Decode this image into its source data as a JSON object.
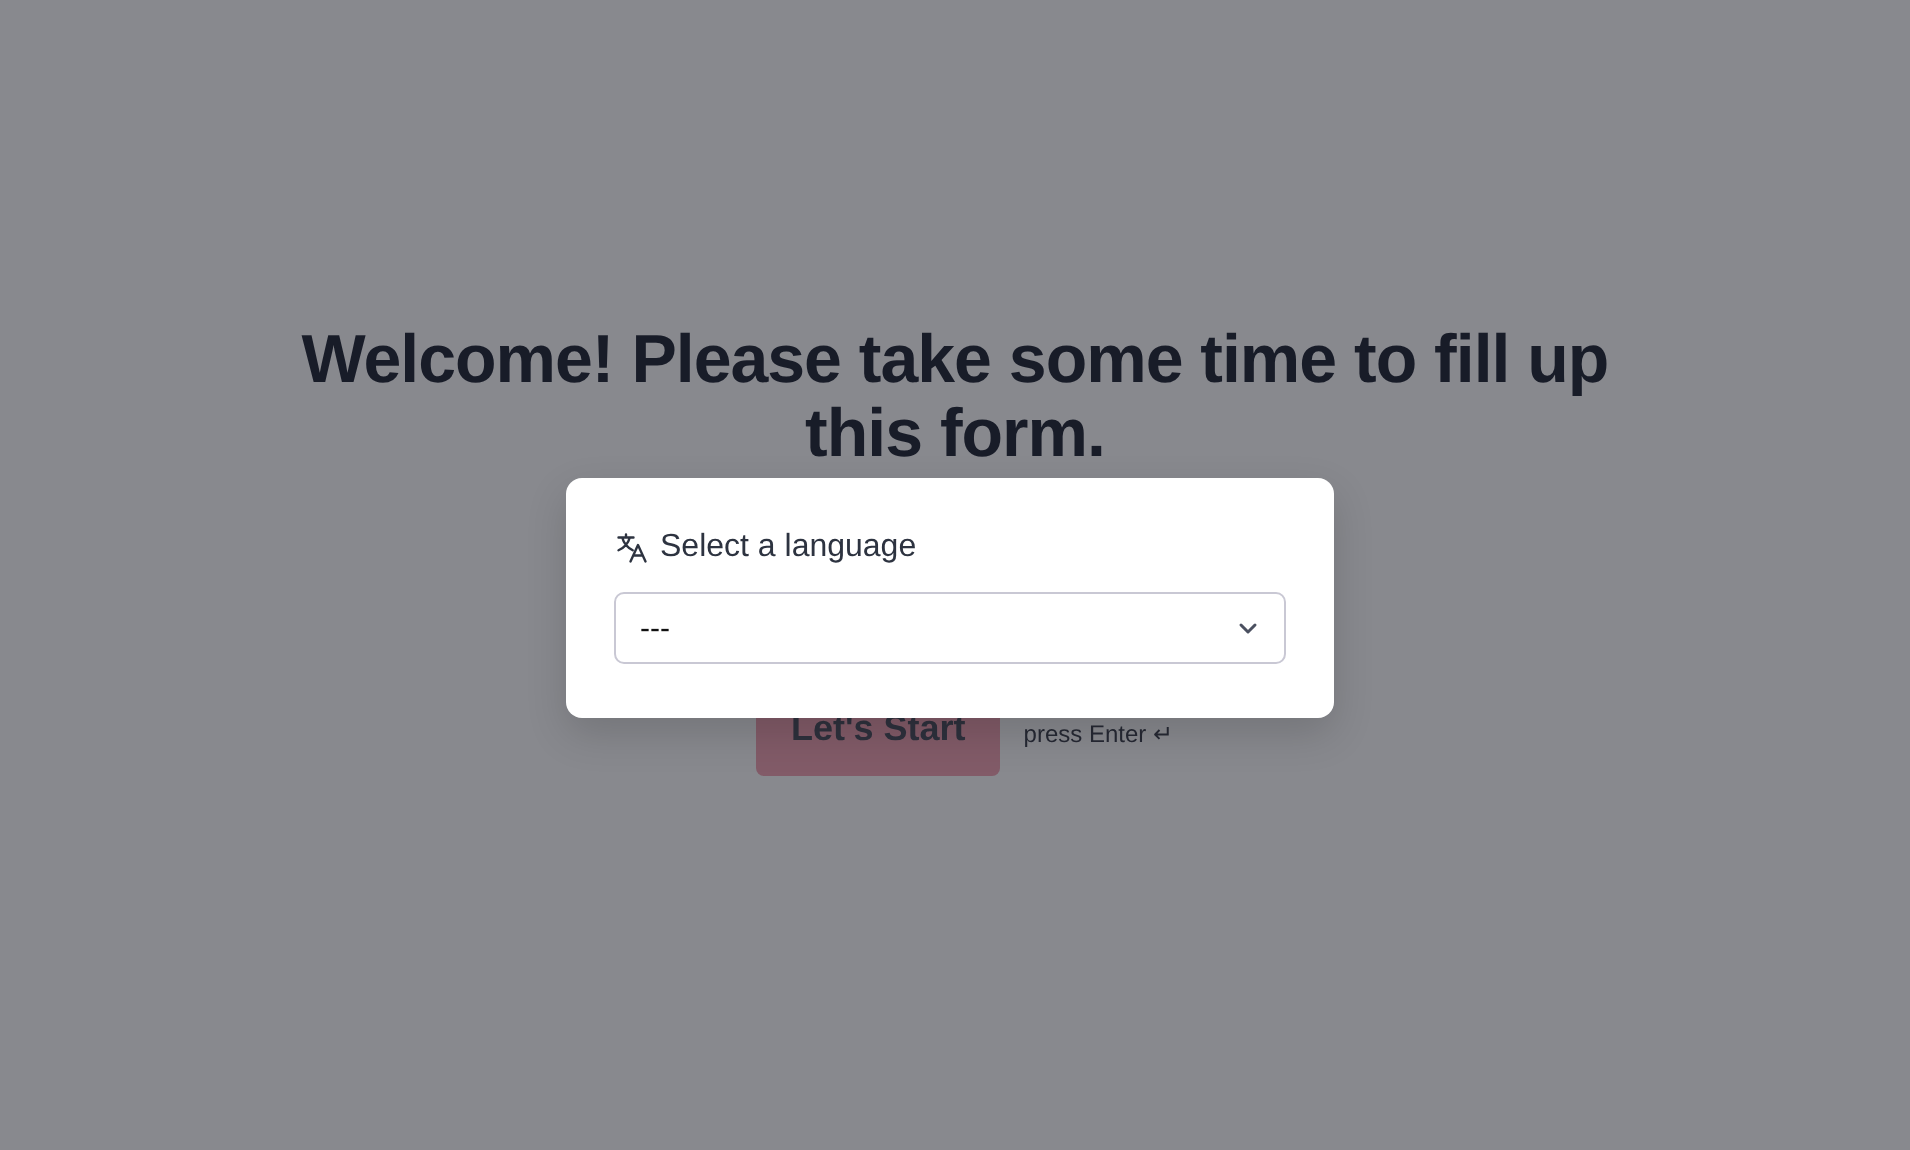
{
  "page": {
    "heading": "Welcome! Please take some time to fill up this form.",
    "start_button": "Let's Start",
    "hint": "press Enter ↵"
  },
  "dialog": {
    "title": "Select a language",
    "select": {
      "value": "---"
    }
  }
}
